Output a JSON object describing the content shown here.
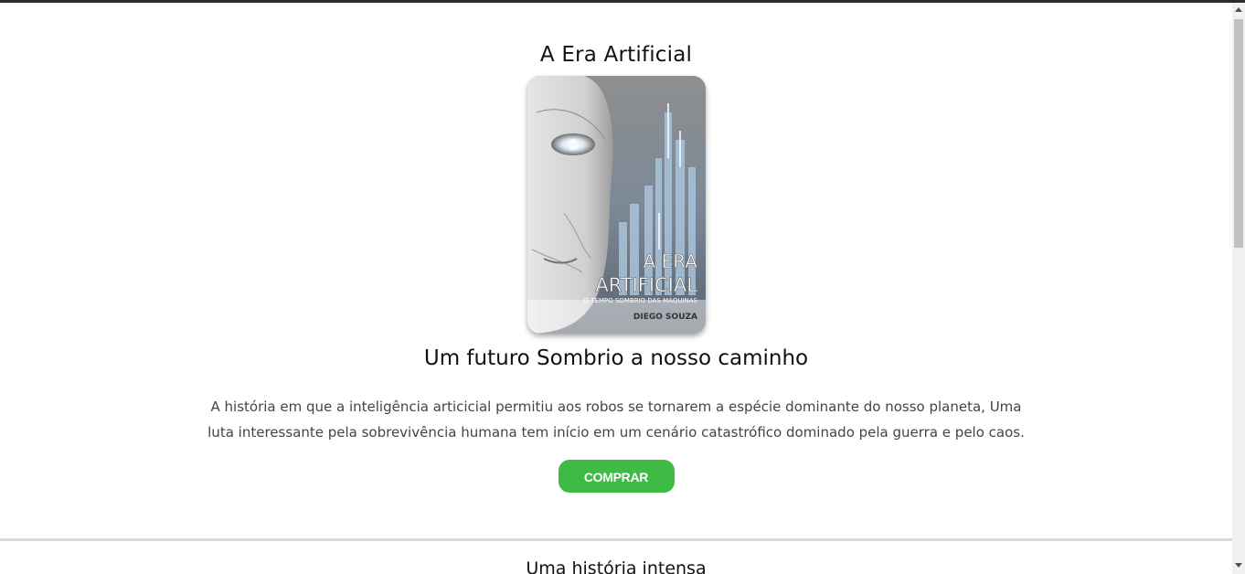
{
  "book": {
    "title": "A Era Artificial",
    "cover": {
      "title_line1": "A ERA",
      "title_line2": "ARTIFICIAL",
      "tagline": "O TEMPO SOMBRIO DAS MÁQUINAS",
      "author": "DIEGO SOUZA"
    },
    "subtitle": "Um futuro Sombrio a nosso caminho",
    "description": "A história em que a inteligência articicial permitiu aos robos se tornarem a espécie dominante do nosso planeta, Uma luta interessante pela sobrevivência humana tem início em um cenário catastrófico dominado pela guerra e pelo caos.",
    "buy_label": "COMPRAR"
  },
  "next_section": {
    "title": "Uma história intensa"
  },
  "colors": {
    "button": "#3dbb45",
    "divider": "#d9d9d9",
    "top_border": "#2b2b2b"
  }
}
